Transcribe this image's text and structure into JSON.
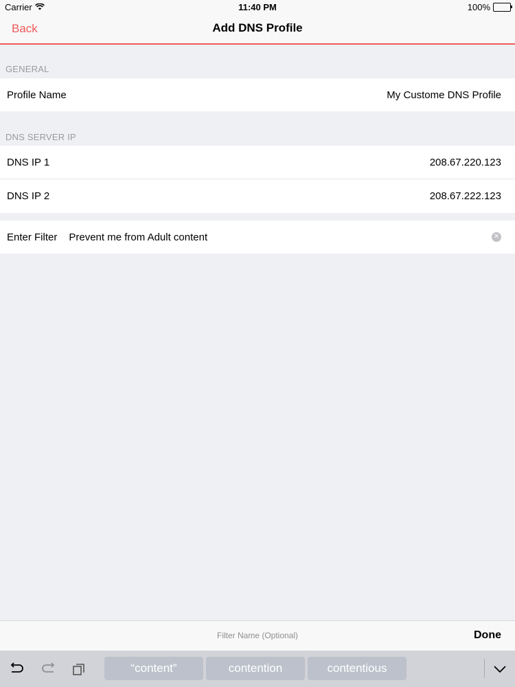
{
  "status_bar": {
    "carrier": "Carrier",
    "time": "11:40 PM",
    "battery": "100%"
  },
  "nav": {
    "back_label": "Back",
    "title": "Add DNS Profile"
  },
  "sections": {
    "general_header": "GENERAL",
    "dns_header": "DNS SERVER IP"
  },
  "profile": {
    "label": "Profile Name",
    "value": "My Custome DNS Profile"
  },
  "dns": [
    {
      "label": "DNS IP 1",
      "value": "208.67.220.123"
    },
    {
      "label": "DNS IP 2",
      "value": "208.67.222.123"
    }
  ],
  "filter": {
    "label": "Enter Filter",
    "value": "Prevent me from Adult content"
  },
  "accessory": {
    "placeholder": "Filter Name (Optional)",
    "done_label": "Done"
  },
  "keyboard": {
    "suggestions": [
      "“content”",
      "contention",
      "contentious"
    ]
  },
  "colors": {
    "accent": "#f05a5a",
    "background": "#eff0f4",
    "section_header": "#9a9a9f"
  }
}
